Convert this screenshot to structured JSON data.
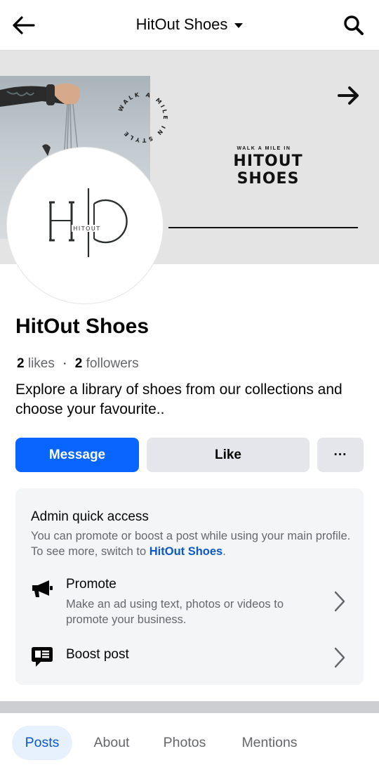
{
  "header": {
    "title": "HitOut Shoes"
  },
  "cover": {
    "stamp_text": "WALK A MILE IN STYLE",
    "tagline": "WALK A MILE IN",
    "brand_line1": "HITOUT",
    "brand_line2": "SHOES"
  },
  "avatar": {
    "logo_letters": "H|O",
    "logo_text": "HITOUT"
  },
  "profile": {
    "name": "HitOut Shoes",
    "likes_count": "2",
    "likes_label": "likes",
    "separator": "·",
    "followers_count": "2",
    "followers_label": "followers",
    "description": "Explore a library of shoes from our collections and choose your favourite.."
  },
  "actions": {
    "message": "Message",
    "like": "Like",
    "more": "···"
  },
  "admin": {
    "title": "Admin quick access",
    "subtitle_prefix": "You can promote or boost a post while using your main profile. To see more, switch to ",
    "subtitle_link": "HitOut Shoes",
    "subtitle_suffix": ".",
    "items": [
      {
        "title": "Promote",
        "subtitle": "Make an ad using text, photos or videos to promote your business.",
        "icon": "megaphone-icon"
      },
      {
        "title": "Boost post",
        "subtitle": "",
        "icon": "boost-post-icon"
      }
    ]
  },
  "tabs": [
    {
      "label": "Posts",
      "active": true
    },
    {
      "label": "About",
      "active": false
    },
    {
      "label": "Photos",
      "active": false
    },
    {
      "label": "Mentions",
      "active": false
    }
  ],
  "colors": {
    "accent": "#0866ff",
    "link": "#0a58ca",
    "secondary_text": "#65676b",
    "button_gray": "#e4e6eb"
  }
}
